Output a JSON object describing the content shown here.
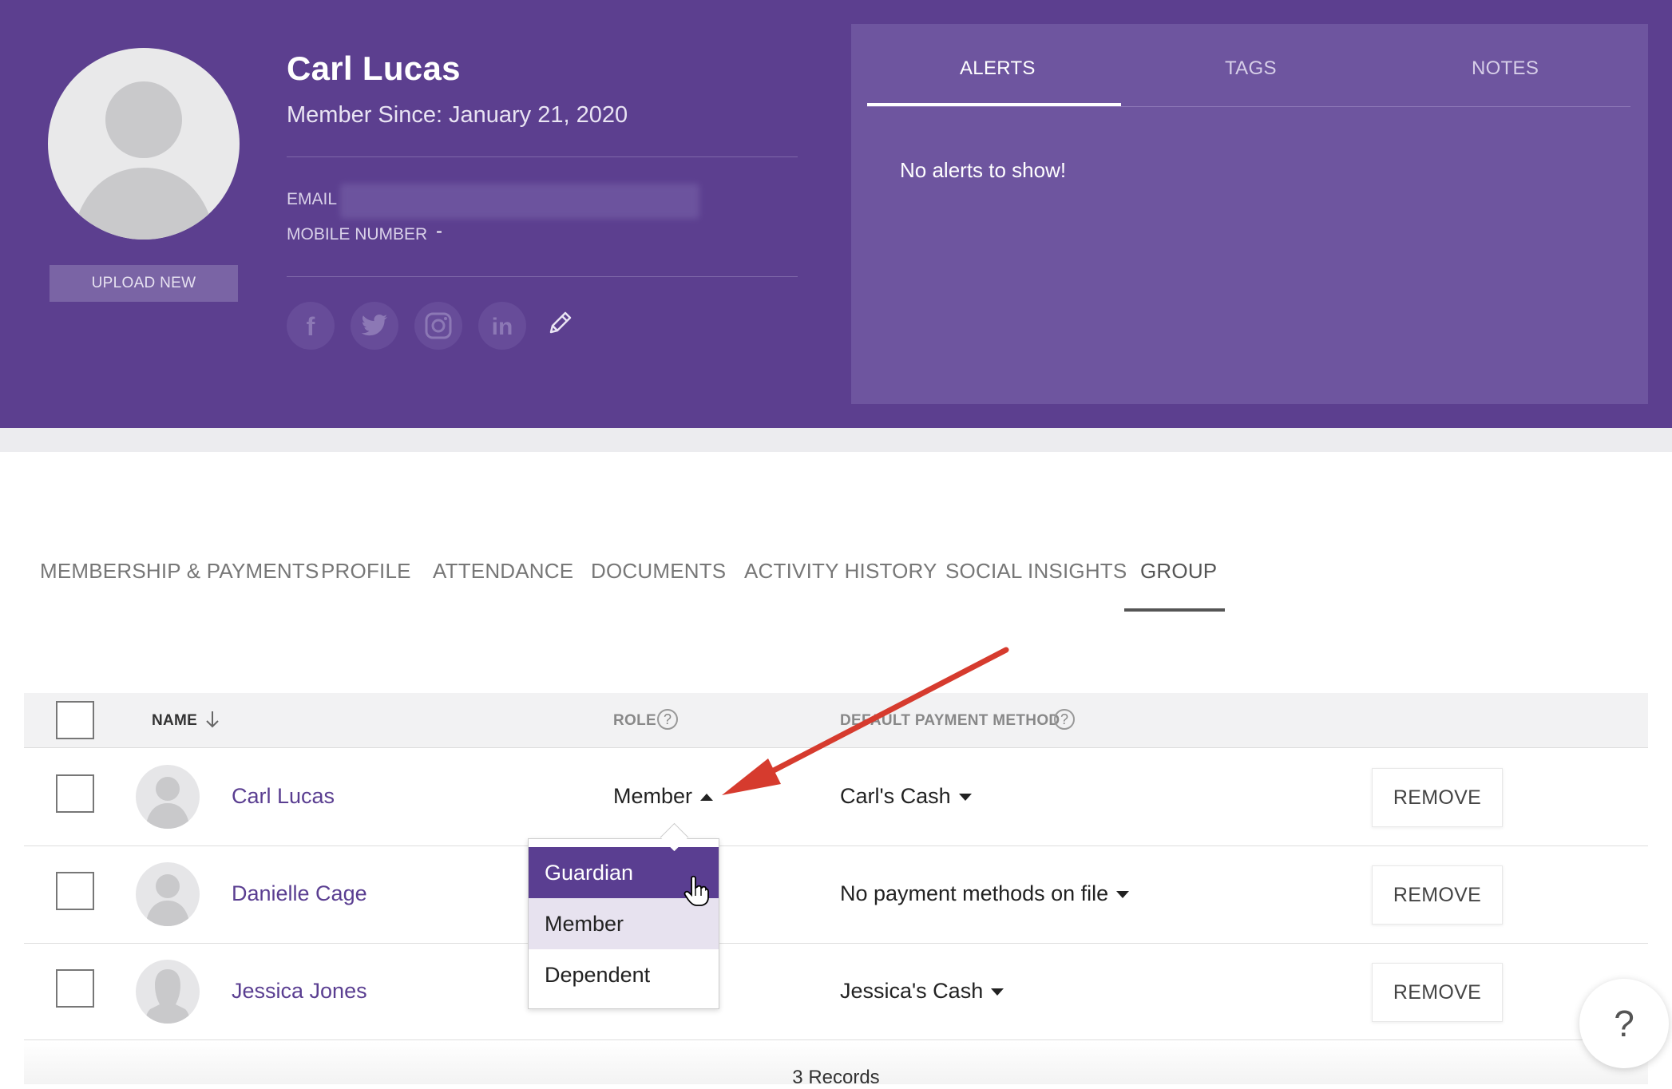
{
  "profile": {
    "name": "Carl Lucas",
    "member_since_label": "Member Since:",
    "member_since_value": "January 21, 2020",
    "email_label": "EMAIL",
    "mobile_label": "MOBILE NUMBER",
    "mobile_value": "-",
    "upload_label": "UPLOAD NEW",
    "social_icons": [
      "facebook-icon",
      "twitter-icon",
      "instagram-icon",
      "linkedin-icon",
      "pencil-icon"
    ]
  },
  "panel": {
    "tabs": [
      "ALERTS",
      "TAGS",
      "NOTES"
    ],
    "active_tab": "ALERTS",
    "empty_message": "No alerts to show!"
  },
  "nav": {
    "tabs": [
      "MEMBERSHIP & PAYMENTS",
      "PROFILE",
      "ATTENDANCE",
      "DOCUMENTS",
      "ACTIVITY HISTORY",
      "SOCIAL INSIGHTS",
      "GROUP"
    ],
    "active_tab": "GROUP"
  },
  "table": {
    "columns": {
      "name": "NAME",
      "role": "ROLE",
      "payment": "DEFAULT PAYMENT METHOD"
    },
    "rows": [
      {
        "name": "Carl Lucas",
        "role": "Member",
        "payment": "Carl's Cash",
        "action": "REMOVE"
      },
      {
        "name": "Danielle Cage",
        "role": "",
        "payment": "No payment methods on file",
        "action": "REMOVE"
      },
      {
        "name": "Jessica Jones",
        "role": "",
        "payment": "Jessica's Cash",
        "action": "REMOVE"
      }
    ],
    "records_label": "3 Records"
  },
  "role_dropdown": {
    "options": [
      "Guardian",
      "Member",
      "Dependent"
    ],
    "hovered": "Guardian",
    "selected": "Member"
  },
  "help_label": "?",
  "colors": {
    "header_bg": "#5c3f8f",
    "panel_bg": "#6e559f",
    "accent": "#5a3e91",
    "annotation_arrow": "#d63b2e"
  }
}
